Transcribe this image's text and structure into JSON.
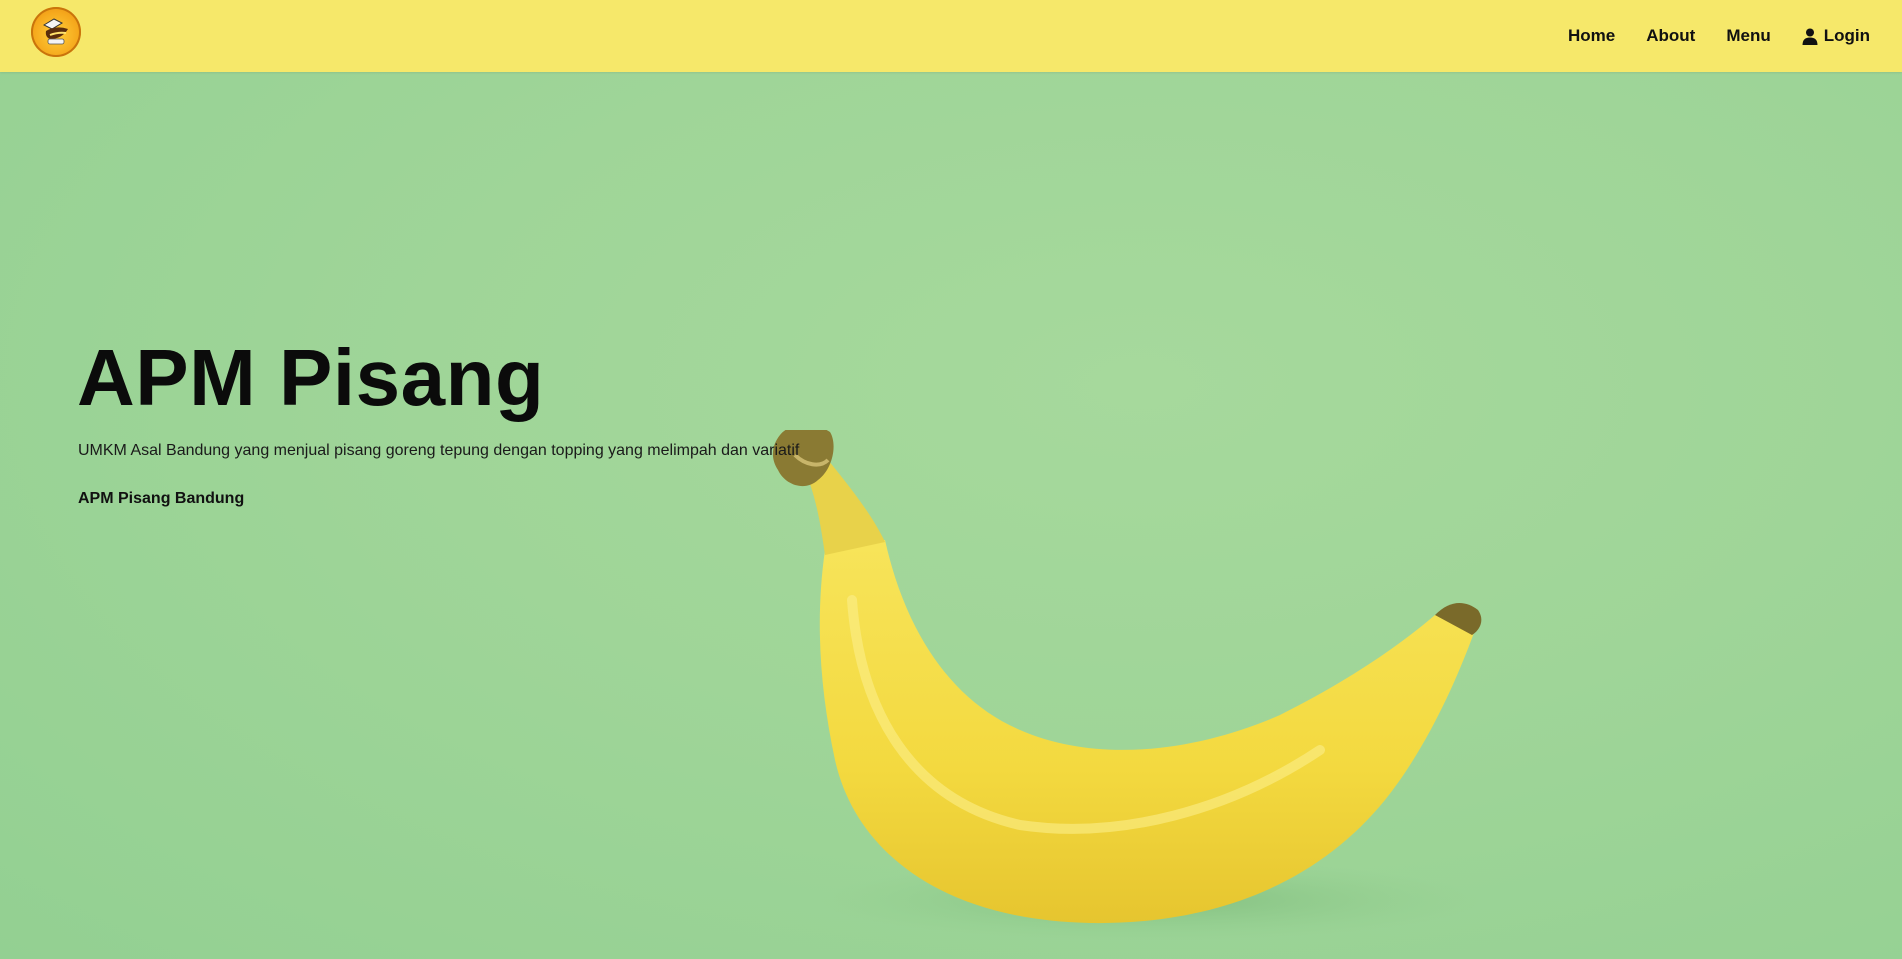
{
  "header": {
    "logo_icon": "banana-logo-icon",
    "nav": [
      {
        "label": "Home"
      },
      {
        "label": "About"
      },
      {
        "label": "Menu"
      },
      {
        "label": "Login",
        "icon": "user-icon"
      }
    ]
  },
  "hero": {
    "title": "APM Pisang",
    "description": "UMKM Asal Bandung yang menjual pisang goreng tepung dengan topping yang melimpah dan variatif",
    "brand": "APM Pisang Bandung"
  },
  "colors": {
    "header_bg": "#f6e86a",
    "hero_bg": "#a2d69a",
    "banana": "#f5dc4a",
    "text": "#0b0b0b"
  }
}
